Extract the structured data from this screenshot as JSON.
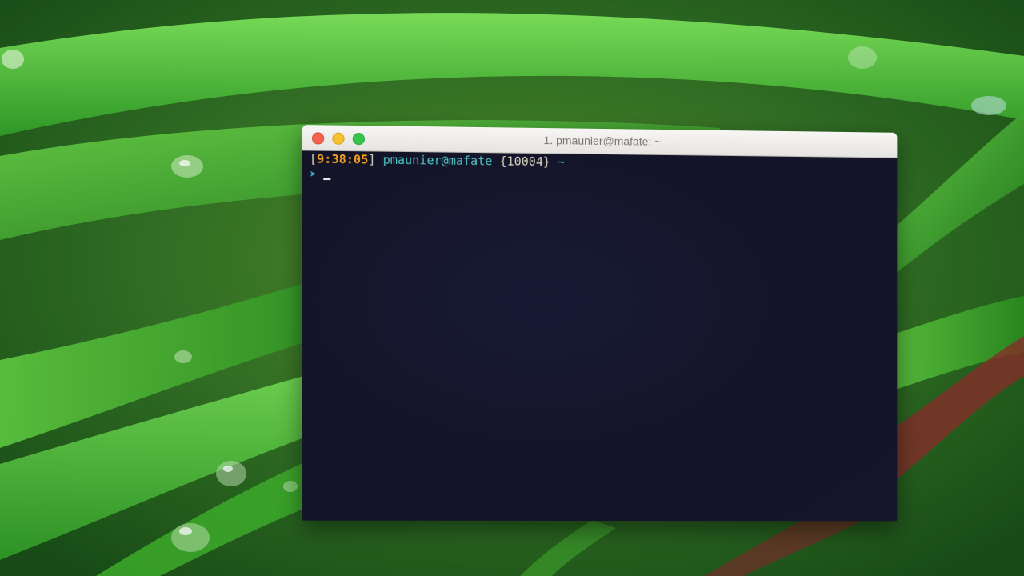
{
  "window": {
    "title": "1. pmaunier@mafate: ~"
  },
  "terminal": {
    "prompt": {
      "open_bracket": "[",
      "time": "9:38:05",
      "close_bracket": "]",
      "user_host": "pmaunier@mafate",
      "job_count": "{10004}",
      "cwd": "~",
      "arrow": "➤"
    }
  },
  "colors": {
    "time": "#f2a024",
    "user_host": "#4ec4c4",
    "prompt_arrow": "#2fb5c4",
    "terminal_background": "#151528",
    "close_button": "#f3624f",
    "minimize_button": "#f5c12e",
    "maximize_button": "#37c44a"
  },
  "icons": {
    "close": "close-icon",
    "minimize": "minimize-icon",
    "maximize": "maximize-icon"
  }
}
